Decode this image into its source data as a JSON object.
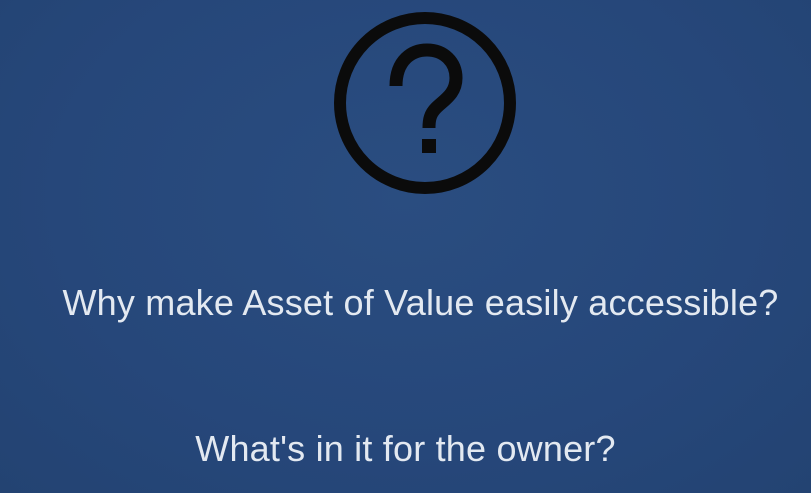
{
  "slide": {
    "icon": "question-mark-circle-icon",
    "colors": {
      "background": "#27497a",
      "text": "#e3e9f1",
      "icon": "#0b0b0b"
    },
    "lines": [
      "Why make Asset of Value easily accessible?",
      "What's in it for the owner?"
    ]
  }
}
